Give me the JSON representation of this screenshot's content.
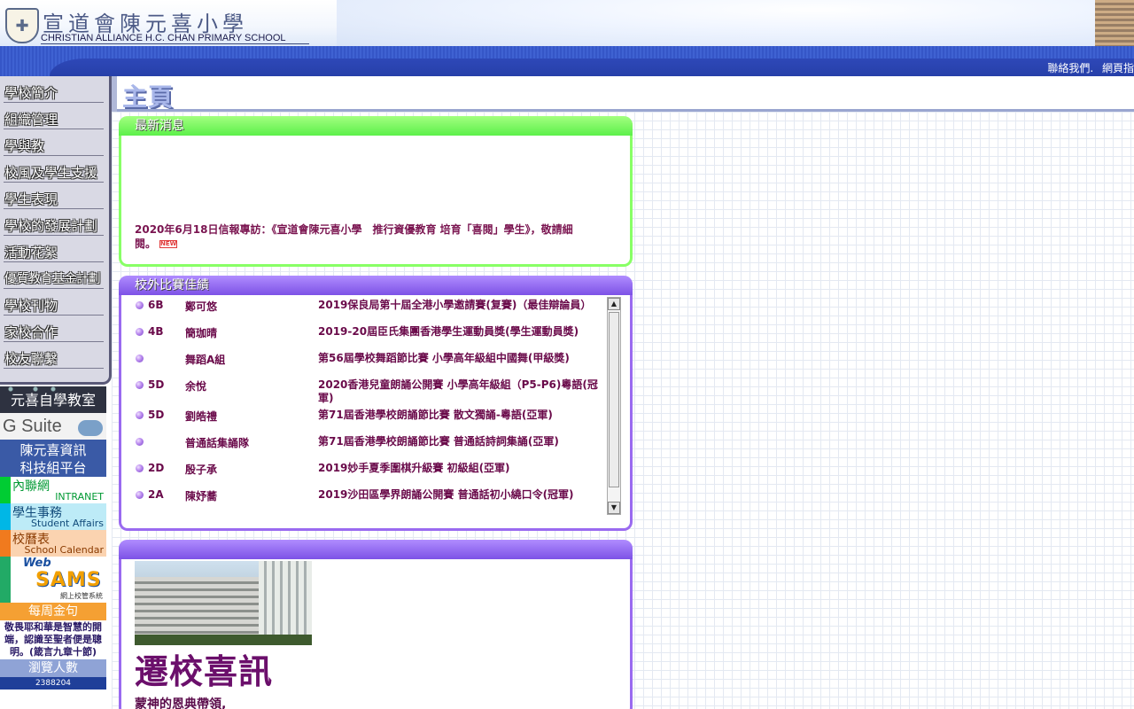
{
  "header": {
    "school_name_zh": "宣道會陳元喜小學",
    "school_name_en": "CHRISTIAN ALLIANCE H.C. CHAN PRIMARY SCHOOL",
    "top_links": [
      "聯絡我們.",
      "網頁指"
    ]
  },
  "sidebar": {
    "items": [
      {
        "label": "學校簡介"
      },
      {
        "label": "組織管理"
      },
      {
        "label": "學與教"
      },
      {
        "label": "校風及學生支援"
      },
      {
        "label": "學生表現"
      },
      {
        "label": "學校的發展計劃"
      },
      {
        "label": "活動花絮"
      },
      {
        "label": "優質教育基金計劃"
      },
      {
        "label": "學校刊物"
      },
      {
        "label": "家校合作"
      },
      {
        "label": "校友聯繫"
      }
    ]
  },
  "banners": {
    "self_learning": "元喜自學教室",
    "gsuite": "G Suite",
    "ict": [
      "陳元喜資訊",
      "科技組平台"
    ],
    "intranet": {
      "zh": "內聯網",
      "en": "INTRANET"
    },
    "student_affairs": {
      "zh": "學生事務",
      "en": "Student Affairs"
    },
    "calendar": {
      "zh": "校曆表",
      "en": "School Calendar"
    },
    "websams": {
      "web": "Web",
      "sams": "SAMS",
      "sub": "網上校管系統"
    },
    "weekly_verse_title": "每周金句",
    "weekly_verse": "敬畏耶和華是智慧的開端，認識至聖者便是聰明。(箴言九章十節)",
    "visits_title": "瀏覽人數",
    "visits_count": "2388204"
  },
  "main": {
    "page_title": "主頁",
    "news": {
      "title": "最新消息",
      "text": "2020年6月18日信報專訪：《宣道會陳元喜小學　推行資優教育 培育「喜閱」學生》，敬請細閱。",
      "badge": "NEW"
    },
    "awards": {
      "title": "校外比賽佳績",
      "rows": [
        {
          "cls": "6B",
          "name": "鄭可悠",
          "award": "2019保良局第十屆全港小學邀請賽(复賽)（最佳辯論員）"
        },
        {
          "cls": "4B",
          "name": "簡珈晴",
          "award": "2019-20屆臣氏集團香港學生運動員獎(學生運動員獎)"
        },
        {
          "cls": "",
          "name": "舞蹈A組",
          "award": "第56屆學校舞蹈節比賽 小學高年級組中國舞(甲級獎)"
        },
        {
          "cls": "5D",
          "name": "余悅",
          "award": "2020香港兒童朗誦公開賽 小學高年級組（P5-P6)粵語(冠軍)"
        },
        {
          "cls": "5D",
          "name": "劉皓禮",
          "award": "第71屆香港學校朗誦節比賽 散文獨誦-粵語(亞軍)"
        },
        {
          "cls": "",
          "name": "普通話集誦隊",
          "award": "第71屆香港學校朗誦節比賽 普通話詩詞集誦(亞軍)"
        },
        {
          "cls": "2D",
          "name": "殷子承",
          "award": "2019妙手夏季圍棋升級賽 初級組(亞軍)"
        },
        {
          "cls": "2A",
          "name": "陳妤蕎",
          "award": "2019沙田區學界朗誦公開賽 普通話初小繞口令(冠軍)"
        }
      ]
    },
    "feature": {
      "title": "",
      "heading": "遷校喜訊",
      "text": "蒙神的恩典帶領,"
    }
  },
  "colors": {
    "news_accent": "#5cf04a",
    "awards_accent": "#7d52e6",
    "header_blue": "#2e48b8",
    "text_maroon": "#6a0a4a"
  }
}
